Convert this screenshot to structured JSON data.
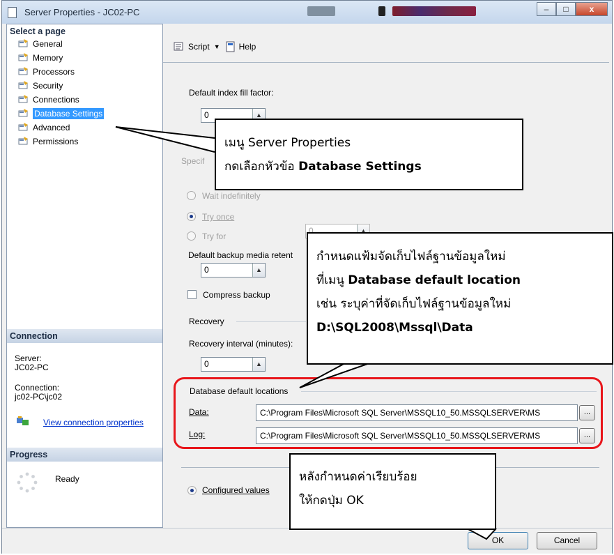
{
  "window": {
    "title": "Server Properties - JC02-PC",
    "buttons": {
      "minimize": "–",
      "maximize": "□",
      "close": "x"
    }
  },
  "left_pane": {
    "select_page_header": "Select a page",
    "pages": [
      "General",
      "Memory",
      "Processors",
      "Security",
      "Connections",
      "Database Settings",
      "Advanced",
      "Permissions"
    ],
    "selected_page": "Database Settings",
    "connection_header": "Connection",
    "server_label": "Server:",
    "server_value": "JC02-PC",
    "connection_label": "Connection:",
    "connection_value": "jc02-PC\\jc02",
    "view_connection_link": "View connection properties",
    "progress_header": "Progress",
    "progress_status": "Ready"
  },
  "toolbar": {
    "script_label": "Script",
    "help_label": "Help"
  },
  "form": {
    "fill_factor_label": "Default index fill factor:",
    "fill_factor_value": "0",
    "specify_label": "Specif",
    "wait_label": "Wait indefinitely",
    "try_once_label": "Try once",
    "try_for_label": "Try for",
    "try_for_value": "0",
    "backup_retention_label": "Default backup media retent",
    "backup_retention_value": "0",
    "compress_backup_label": "Compress backup",
    "recovery_group_label": "Recovery",
    "recovery_interval_label": "Recovery interval (minutes):",
    "recovery_interval_value": "0",
    "db_locations_label": "Database default locations",
    "data_label": "Data:",
    "data_path": "C:\\Program Files\\Microsoft SQL Server\\MSSQL10_50.MSSQLSERVER\\MS",
    "log_label": "Log:",
    "log_path": "C:\\Program Files\\Microsoft SQL Server\\MSSQL10_50.MSSQLSERVER\\MS",
    "browse_label": "...",
    "configured_values_label": "Configured values"
  },
  "buttons": {
    "ok": "OK",
    "cancel": "Cancel"
  },
  "callouts": {
    "c1_line1": "เมนู Server Properties",
    "c1_line2_prefix": "กดเลือกหัวข้อ ",
    "c1_line2_bold": "Database Settings",
    "c2_line1": "กำหนดแฟ้มจัดเก็บไฟล์ฐานข้อมูลใหม่",
    "c2_line2_prefix": "ที่เมนู ",
    "c2_line2_bold": "Database default location",
    "c2_line3": "เช่น ระบุค่าที่จัดเก็บไฟล์ฐานข้อมูลใหม่",
    "c2_line4": "D:\\SQL2008\\Mssql\\Data",
    "c3_line1": "หลังกำหนดค่าเรียบร้อย",
    "c3_line2": "ให้กดปุ่ม OK"
  },
  "icons": {
    "page": "page-icon",
    "script": "script-icon",
    "help": "help-icon",
    "connection": "connection-icon",
    "progress": "spinner-icon"
  }
}
